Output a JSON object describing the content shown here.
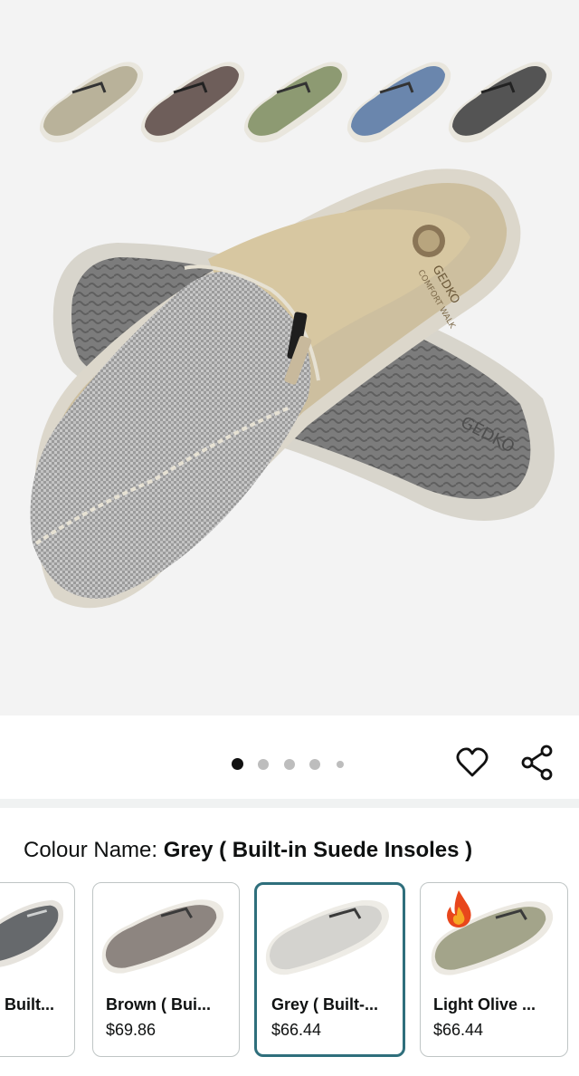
{
  "gallery": {
    "brand_mark": "GEDKO",
    "brand_tagline": "COMFORT WALK",
    "color_previews": [
      {
        "icon": "slipper-khaki-icon",
        "color": "#b9b29a"
      },
      {
        "icon": "slipper-brown-icon",
        "color": "#6e5e5a"
      },
      {
        "icon": "slipper-olive-icon",
        "color": "#8d9a72"
      },
      {
        "icon": "slipper-blue-icon",
        "color": "#6a86ad"
      },
      {
        "icon": "slipper-charcoal-icon",
        "color": "#545454"
      }
    ],
    "page_count": 5,
    "active_page": 1
  },
  "actions": {
    "wishlist_icon": "heart-icon",
    "share_icon": "share-icon"
  },
  "variant": {
    "label": "Colour Name:",
    "selected_value": "Grey ( Built-in Suede Insoles )",
    "options": [
      {
        "name": "Built...",
        "price": "",
        "color": "#66696c",
        "badge": ""
      },
      {
        "name": "Brown ( Bui...",
        "price": "$69.86",
        "color": "#8d8580",
        "badge": ""
      },
      {
        "name": "Grey ( Built-...",
        "price": "$66.44",
        "color": "#d4d3cf",
        "badge": "",
        "selected": true
      },
      {
        "name": "Light Olive ...",
        "price": "$66.44",
        "color": "#a3a48a",
        "badge": "fire-icon"
      }
    ]
  },
  "colors": {
    "accent_border": "#2f6f7c",
    "hero_background": "#f3f3f3",
    "canvas_grey": "#a8a8a8"
  }
}
